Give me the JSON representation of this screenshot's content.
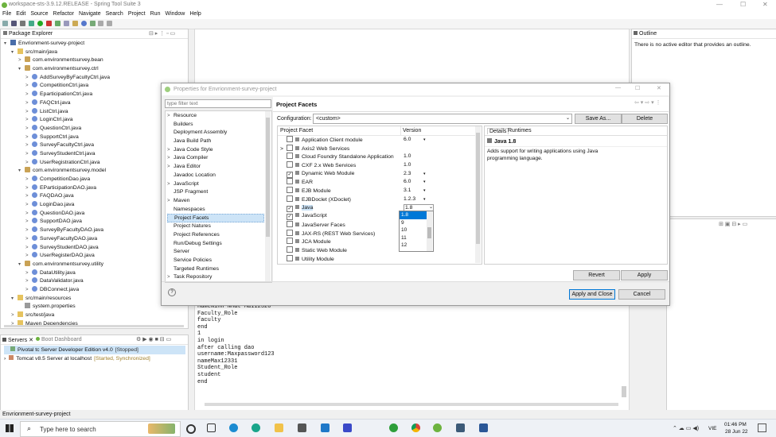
{
  "window": {
    "title": "workspace-sts-3.9.12.RELEASE - Spring Tool Suite 3"
  },
  "menu": [
    "File",
    "Edit",
    "Source",
    "Refactor",
    "Navigate",
    "Search",
    "Project",
    "Run",
    "Window",
    "Help"
  ],
  "package_explorer": {
    "tab": "Package Explorer",
    "items": [
      {
        "label": "Envrionment-survey-project",
        "level": 0,
        "icon": "proj",
        "tri": "▾"
      },
      {
        "label": "src/main/java",
        "level": 1,
        "icon": "folder",
        "tri": "▾"
      },
      {
        "label": "com.environmentsurvey.bean",
        "level": 2,
        "icon": "pkg",
        "tri": ">"
      },
      {
        "label": "com.environmentsurvey.ctrl",
        "level": 2,
        "icon": "pkg",
        "tri": "▾"
      },
      {
        "label": "AddSurveyByFacultyCtrl.java",
        "level": 3,
        "icon": "java",
        "tri": ">"
      },
      {
        "label": "CompetitionCtrl.java",
        "level": 3,
        "icon": "java",
        "tri": ">"
      },
      {
        "label": "EparticipationCtrl.java",
        "level": 3,
        "icon": "java",
        "tri": ">"
      },
      {
        "label": "FAQCtrl.java",
        "level": 3,
        "icon": "java",
        "tri": ">"
      },
      {
        "label": "ListCtrl.java",
        "level": 3,
        "icon": "java",
        "tri": ">"
      },
      {
        "label": "LoginCtrl.java",
        "level": 3,
        "icon": "java",
        "tri": ">"
      },
      {
        "label": "QuestionCtrl.java",
        "level": 3,
        "icon": "java",
        "tri": ">"
      },
      {
        "label": "SupportCtrl.java",
        "level": 3,
        "icon": "java",
        "tri": ">"
      },
      {
        "label": "SurveyFacultyCtrl.java",
        "level": 3,
        "icon": "java",
        "tri": ">"
      },
      {
        "label": "SurveyStudentCtrl.java",
        "level": 3,
        "icon": "java",
        "tri": ">"
      },
      {
        "label": "UserRegistrationCtrl.java",
        "level": 3,
        "icon": "java",
        "tri": ">"
      },
      {
        "label": "com.environmentsurvey.model",
        "level": 2,
        "icon": "pkg",
        "tri": "▾"
      },
      {
        "label": "CompetitionDao.java",
        "level": 3,
        "icon": "java",
        "tri": ">"
      },
      {
        "label": "EParticipationDAO.java",
        "level": 3,
        "icon": "java",
        "tri": ">"
      },
      {
        "label": "FAQDAO.java",
        "level": 3,
        "icon": "java",
        "tri": ">"
      },
      {
        "label": "LoginDao.java",
        "level": 3,
        "icon": "java",
        "tri": ">"
      },
      {
        "label": "QuestionDAO.java",
        "level": 3,
        "icon": "java",
        "tri": ">"
      },
      {
        "label": "SupportDAO.java",
        "level": 3,
        "icon": "java",
        "tri": ">"
      },
      {
        "label": "SurveyByFacultyDAO.java",
        "level": 3,
        "icon": "java",
        "tri": ">"
      },
      {
        "label": "SurveyFacultyDAO.java",
        "level": 3,
        "icon": "java",
        "tri": ">"
      },
      {
        "label": "SurveyStudentDAO.java",
        "level": 3,
        "icon": "java",
        "tri": ">"
      },
      {
        "label": "UserRegisterDAO.java",
        "level": 3,
        "icon": "java",
        "tri": ">"
      },
      {
        "label": "com.environmentsurvey.utility",
        "level": 2,
        "icon": "pkg",
        "tri": "▾"
      },
      {
        "label": "DataUtility.java",
        "level": 3,
        "icon": "java",
        "tri": ">"
      },
      {
        "label": "DataValidator.java",
        "level": 3,
        "icon": "java",
        "tri": ">"
      },
      {
        "label": "DBConnect.java",
        "level": 3,
        "icon": "java",
        "tri": ">"
      },
      {
        "label": "src/main/resources",
        "level": 1,
        "icon": "folder",
        "tri": "▾"
      },
      {
        "label": "system.properties",
        "level": 2,
        "icon": "file",
        "tri": ""
      },
      {
        "label": "src/test/java",
        "level": 1,
        "icon": "folder",
        "tri": ">"
      },
      {
        "label": "Maven Dependencies",
        "level": 1,
        "icon": "folder",
        "tri": ">"
      }
    ]
  },
  "servers": {
    "tab_servers": "Servers",
    "tab_boot": "Boot Dashboard",
    "rows": [
      {
        "name": "Pivotal tc Server Developer Edition v4.0",
        "status": "[Stopped]"
      },
      {
        "name": "Tomcat v8.5 Server at localhost",
        "status": "[Started, Synchronized]"
      }
    ]
  },
  "outline": {
    "tab": "Outline",
    "message": "There is no active editor that provides an outline."
  },
  "console": {
    "lines": [
      "nameNinh Nhat Mai12320",
      "Faculty_Role",
      "faculty",
      "end",
      "1",
      "in login",
      "after calling dao",
      "username:Maxpassword123",
      "nameMax12331",
      "Student_Role",
      "student",
      "end"
    ]
  },
  "status_bar": "Envrionment-survey-project",
  "dialog": {
    "title": "Properties for Envrionment-survey-project",
    "filter_placeholder": "type filter text",
    "nav": [
      {
        "label": "Resource",
        "tri": ">"
      },
      {
        "label": "Builders",
        "tri": ""
      },
      {
        "label": "Deployment Assembly",
        "tri": ""
      },
      {
        "label": "Java Build Path",
        "tri": ""
      },
      {
        "label": "Java Code Style",
        "tri": ">"
      },
      {
        "label": "Java Compiler",
        "tri": ">"
      },
      {
        "label": "Java Editor",
        "tri": ">"
      },
      {
        "label": "Javadoc Location",
        "tri": ""
      },
      {
        "label": "JavaScript",
        "tri": ">"
      },
      {
        "label": "JSP Fragment",
        "tri": ""
      },
      {
        "label": "Maven",
        "tri": ">"
      },
      {
        "label": "Namespaces",
        "tri": ""
      },
      {
        "label": "Project Facets",
        "tri": "",
        "selected": true
      },
      {
        "label": "Project Natures",
        "tri": ""
      },
      {
        "label": "Project References",
        "tri": ""
      },
      {
        "label": "Run/Debug Settings",
        "tri": ""
      },
      {
        "label": "Server",
        "tri": ""
      },
      {
        "label": "Service Policies",
        "tri": ""
      },
      {
        "label": "Targeted Runtimes",
        "tri": ""
      },
      {
        "label": "Task Repository",
        "tri": ">"
      }
    ],
    "heading": "Project Facets",
    "configuration_label": "Configuration:",
    "configuration_value": "<custom>",
    "save_as": "Save As...",
    "delete": "Delete",
    "col_facet": "Project Facet",
    "col_version": "Version",
    "facets": [
      {
        "name": "Application Client module",
        "version": "6.0",
        "checked": false,
        "arrow": true,
        "expander": ""
      },
      {
        "name": "Axis2 Web Services",
        "version": "",
        "checked": false,
        "arrow": false,
        "expander": ">"
      },
      {
        "name": "Cloud Foundry Standalone Application",
        "version": "1.0",
        "checked": false,
        "arrow": false,
        "expander": ""
      },
      {
        "name": "CXF 2.x Web Services",
        "version": "1.0",
        "checked": false,
        "arrow": false,
        "expander": ""
      },
      {
        "name": "Dynamic Web Module",
        "version": "2.3",
        "checked": true,
        "arrow": true,
        "expander": ""
      },
      {
        "name": "EAR",
        "version": "6.0",
        "checked": false,
        "arrow": true,
        "expander": ""
      },
      {
        "name": "EJB Module",
        "version": "3.1",
        "checked": false,
        "arrow": true,
        "expander": ""
      },
      {
        "name": "EJBDoclet (XDoclet)",
        "version": "1.2.3",
        "checked": false,
        "arrow": true,
        "expander": ""
      },
      {
        "name": "Java",
        "version": "1.8",
        "checked": true,
        "arrow": false,
        "expander": "",
        "selected": true
      },
      {
        "name": "JavaScript",
        "version": "",
        "checked": true,
        "arrow": false,
        "expander": ""
      },
      {
        "name": "JavaServer Faces",
        "version": "",
        "checked": false,
        "arrow": false,
        "expander": ""
      },
      {
        "name": "JAX-RS (REST Web Services)",
        "version": "",
        "checked": false,
        "arrow": false,
        "expander": ""
      },
      {
        "name": "JCA Module",
        "version": "",
        "checked": false,
        "arrow": false,
        "expander": ""
      },
      {
        "name": "Static Web Module",
        "version": "",
        "checked": false,
        "arrow": false,
        "expander": ""
      },
      {
        "name": "Utility Module",
        "version": "",
        "checked": false,
        "arrow": false,
        "expander": ""
      }
    ],
    "version_dropdown": [
      "1.8",
      "9",
      "10",
      "11",
      "12"
    ],
    "details_tab": "Details",
    "runtimes_tab": "Runtimes",
    "details_title": "Java 1.8",
    "details_text": "Adds support for writing applications using Java programming language.",
    "revert": "Revert",
    "apply": "Apply",
    "apply_close": "Apply and Close",
    "cancel": "Cancel"
  },
  "taskbar": {
    "search_placeholder": "Type here to search",
    "time": "01:46 PM",
    "date": "28 Jun 22",
    "lang": "VIE"
  }
}
